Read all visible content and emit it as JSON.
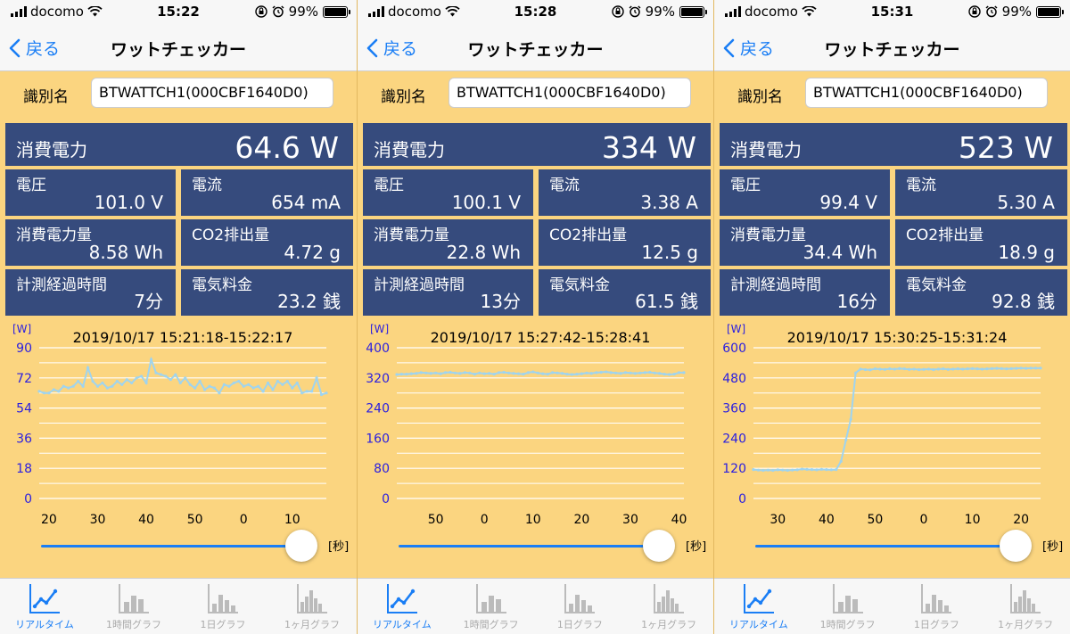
{
  "app": {
    "carrier": "docomo",
    "battery": "99%",
    "back_label": "戻る",
    "title": "ワットチェッカー",
    "id_label": "識別名",
    "sec_label": "[秒]",
    "tabs": [
      "リアルタイム",
      "1時間グラフ",
      "1日グラフ",
      "1ヶ月グラフ"
    ]
  },
  "labels": {
    "power": "消費電力",
    "voltage": "電圧",
    "current": "電流",
    "energy": "消費電力量",
    "co2": "CO2排出量",
    "elapsed": "計測経過時間",
    "cost": "電気料金"
  },
  "colors": {
    "background": "#fbd580",
    "card": "#364b7d",
    "accent": "#1a7ef5",
    "line": "#9fd4ef",
    "axis_label": "#2a1ee0"
  },
  "screens": [
    {
      "time": "15:22",
      "device_id": "BTWATTCH1(000CBF1640D0)",
      "power": "64.6 W",
      "voltage": "101.0 V",
      "current": "654 mA",
      "energy": "8.58 Wh",
      "co2": "4.72 g",
      "elapsed": "7分",
      "cost": "23.2 銭"
    },
    {
      "time": "15:28",
      "device_id": "BTWATTCH1(000CBF1640D0)",
      "power": "334 W",
      "voltage": "100.1 V",
      "current": "3.38 A",
      "energy": "22.8 Wh",
      "co2": "12.5 g",
      "elapsed": "13分",
      "cost": "61.5 銭"
    },
    {
      "time": "15:31",
      "device_id": "BTWATTCH1(000CBF1640D0)",
      "power": "523 W",
      "voltage": "99.4 V",
      "current": "5.30 A",
      "energy": "34.4 Wh",
      "co2": "18.9 g",
      "elapsed": "16分",
      "cost": "92.8 銭"
    }
  ],
  "chart_data": [
    {
      "type": "line",
      "title": "2019/10/17 15:21:18-15:22:17",
      "ylabel": "[W]",
      "ylim": [
        0,
        90
      ],
      "yticks": [
        0,
        18,
        36,
        54,
        72,
        90
      ],
      "xlim": [
        18,
        77
      ],
      "xticks": [
        20,
        30,
        40,
        50,
        60,
        70
      ],
      "xtick_labels": [
        "20",
        "30",
        "40",
        "50",
        "0",
        "10"
      ],
      "grid": true,
      "series": [
        {
          "x": [
            18,
            19,
            20,
            21,
            22,
            23,
            24,
            25,
            26,
            27,
            28,
            29,
            30,
            31,
            32,
            33,
            34,
            35,
            36,
            37,
            38,
            39,
            40,
            41,
            42,
            43,
            44,
            45,
            46,
            47,
            48,
            49,
            50,
            51,
            52,
            53,
            54,
            55,
            56,
            57,
            58,
            59,
            60,
            61,
            62,
            63,
            64,
            65,
            66,
            67,
            68,
            69,
            70,
            71,
            72,
            73,
            74,
            75,
            76,
            77
          ],
          "values": [
            64,
            63,
            63,
            65,
            64,
            67,
            66,
            67,
            70,
            67,
            78,
            70,
            67,
            69,
            66,
            67,
            70,
            68,
            71,
            69,
            72,
            73,
            69,
            83,
            75,
            74,
            73,
            71,
            74,
            69,
            72,
            68,
            66,
            70,
            65,
            67,
            66,
            63,
            68,
            67,
            69,
            70,
            67,
            68,
            66,
            67,
            64,
            69,
            65,
            70,
            68,
            70,
            66,
            69,
            63,
            64,
            64,
            72,
            62,
            63
          ]
        }
      ]
    },
    {
      "type": "line",
      "title": "2019/10/17 15:27:42-15:28:41",
      "ylabel": "[W]",
      "ylim": [
        0,
        400
      ],
      "yticks": [
        0,
        80,
        160,
        240,
        320,
        400
      ],
      "xlim": [
        42,
        101
      ],
      "xticks": [
        50,
        60,
        70,
        80,
        90,
        100
      ],
      "xtick_labels": [
        "50",
        "0",
        "10",
        "20",
        "30",
        "40"
      ],
      "grid": true,
      "series": [
        {
          "x": [
            42,
            43,
            44,
            45,
            46,
            47,
            48,
            49,
            50,
            51,
            52,
            53,
            54,
            55,
            56,
            57,
            58,
            59,
            60,
            61,
            62,
            63,
            64,
            65,
            66,
            67,
            68,
            69,
            70,
            71,
            72,
            73,
            74,
            75,
            76,
            77,
            78,
            79,
            80,
            81,
            82,
            83,
            84,
            85,
            86,
            87,
            88,
            89,
            90,
            91,
            92,
            93,
            94,
            95,
            96,
            97,
            98,
            99,
            100,
            101
          ],
          "values": [
            329,
            330,
            330,
            331,
            332,
            334,
            333,
            332,
            333,
            331,
            334,
            335,
            333,
            332,
            334,
            333,
            330,
            333,
            331,
            332,
            330,
            334,
            335,
            333,
            332,
            331,
            330,
            334,
            336,
            333,
            331,
            330,
            334,
            333,
            332,
            330,
            329,
            330,
            331,
            333,
            332,
            334,
            335,
            336,
            334,
            333,
            332,
            334,
            333,
            332,
            333,
            334,
            335,
            333,
            332,
            330,
            329,
            330,
            334,
            334
          ]
        }
      ]
    },
    {
      "type": "line",
      "title": "2019/10/17 15:30:25-15:31:24",
      "ylabel": "[W]",
      "ylim": [
        0,
        600
      ],
      "yticks": [
        0,
        120,
        240,
        360,
        480,
        600
      ],
      "xlim": [
        25,
        84
      ],
      "xticks": [
        30,
        40,
        50,
        60,
        70,
        80
      ],
      "xtick_labels": [
        "30",
        "40",
        "50",
        "0",
        "10",
        "20"
      ],
      "grid": true,
      "series": [
        {
          "x": [
            25,
            26,
            27,
            28,
            29,
            30,
            31,
            32,
            33,
            34,
            35,
            36,
            37,
            38,
            39,
            40,
            41,
            42,
            43,
            44,
            45,
            46,
            47,
            48,
            49,
            50,
            51,
            52,
            53,
            54,
            55,
            56,
            57,
            58,
            59,
            60,
            61,
            62,
            63,
            64,
            65,
            66,
            67,
            68,
            69,
            70,
            71,
            72,
            73,
            74,
            75,
            76,
            77,
            78,
            79,
            80,
            81,
            82,
            83,
            84
          ],
          "values": [
            115,
            113,
            112,
            113,
            112,
            114,
            113,
            112,
            113,
            114,
            117,
            116,
            115,
            114,
            116,
            115,
            114,
            115,
            148,
            233,
            315,
            500,
            515,
            513,
            512,
            516,
            515,
            514,
            516,
            515,
            517,
            516,
            514,
            515,
            513,
            514,
            515,
            513,
            515,
            516,
            514,
            515,
            516,
            515,
            516,
            517,
            516,
            515,
            516,
            517,
            518,
            517,
            516,
            517,
            518,
            519,
            518,
            519,
            519,
            519
          ]
        }
      ]
    }
  ]
}
